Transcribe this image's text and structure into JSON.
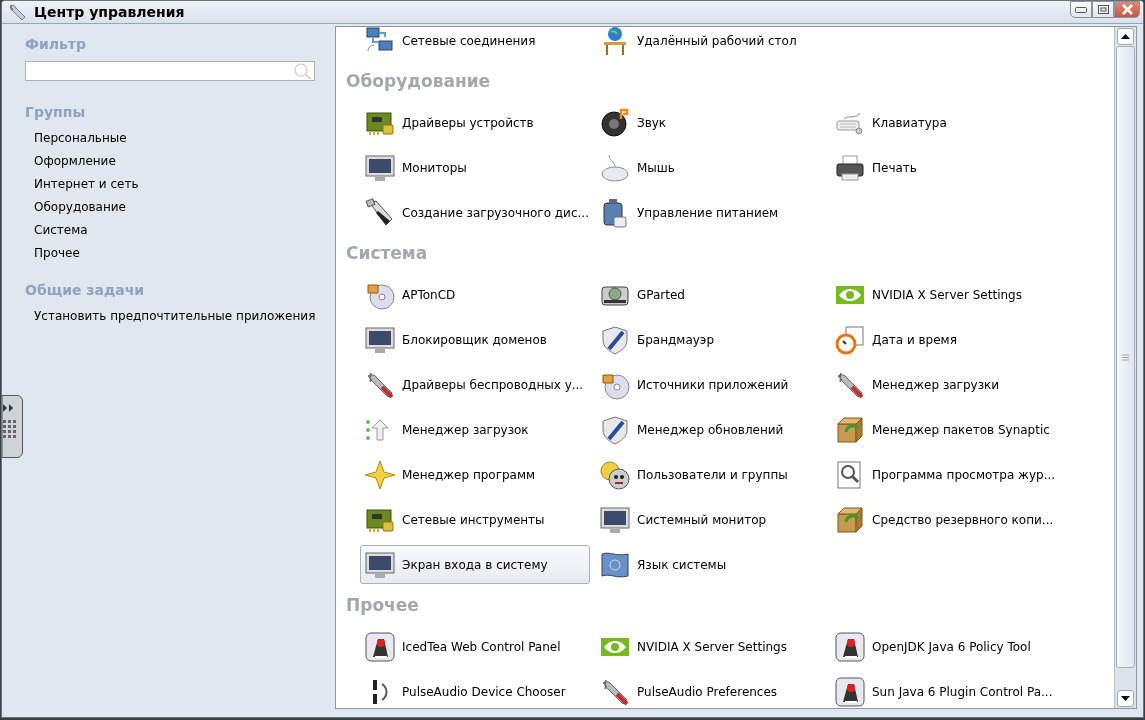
{
  "window": {
    "title": "Центр управления"
  },
  "sidebar": {
    "filter_heading": "Фильтр",
    "groups_heading": "Группы",
    "groups": [
      "Персональные",
      "Оформление",
      "Интернет и сеть",
      "Оборудование",
      "Система",
      "Прочее"
    ],
    "tasks_heading": "Общие задачи",
    "tasks": [
      "Установить предпочтительные приложения"
    ]
  },
  "sections": [
    {
      "items": [
        {
          "label": "Сетевые соединения",
          "selected": false
        },
        {
          "label": "Удалённый рабочий стол",
          "selected": false
        }
      ]
    },
    {
      "heading": "Оборудование",
      "items": [
        {
          "label": "Драйверы устройств",
          "selected": false
        },
        {
          "label": "Звук",
          "selected": false
        },
        {
          "label": "Клавиатура",
          "selected": false
        },
        {
          "label": "Мониторы",
          "selected": false
        },
        {
          "label": "Мышь",
          "selected": false
        },
        {
          "label": "Печать",
          "selected": false
        },
        {
          "label": "Создание загрузочного дис...",
          "selected": false
        },
        {
          "label": "Управление питанием",
          "selected": false
        }
      ]
    },
    {
      "heading": "Система",
      "items": [
        {
          "label": "APTonCD",
          "selected": false
        },
        {
          "label": "GParted",
          "selected": false
        },
        {
          "label": "NVIDIA X Server Settings",
          "selected": false
        },
        {
          "label": "Блокировщик доменов",
          "selected": false
        },
        {
          "label": "Брандмауэр",
          "selected": false
        },
        {
          "label": "Дата и время",
          "selected": false
        },
        {
          "label": "Драйверы беспроводных у...",
          "selected": false
        },
        {
          "label": "Источники приложений",
          "selected": false
        },
        {
          "label": "Менеджер загрузки",
          "selected": false
        },
        {
          "label": "Менеджер загрузок",
          "selected": false
        },
        {
          "label": "Менеджер обновлений",
          "selected": false
        },
        {
          "label": "Менеджер пакетов Synaptic",
          "selected": false
        },
        {
          "label": "Менеджер программ",
          "selected": false
        },
        {
          "label": "Пользователи и группы",
          "selected": false
        },
        {
          "label": "Программа просмотра жур...",
          "selected": false
        },
        {
          "label": "Сетевые инструменты",
          "selected": false
        },
        {
          "label": "Системный монитор",
          "selected": false
        },
        {
          "label": "Средство резервного копи...",
          "selected": false
        },
        {
          "label": "Экран входа в систему",
          "selected": true
        },
        {
          "label": "Язык системы",
          "selected": false
        }
      ]
    },
    {
      "heading": "Прочее",
      "items": [
        {
          "label": "IcedTea Web Control Panel",
          "selected": false
        },
        {
          "label": "NVIDIA X Server Settings",
          "selected": false
        },
        {
          "label": "OpenJDK Java 6 Policy Tool",
          "selected": false
        },
        {
          "label": "PulseAudio Device Chooser",
          "selected": false
        },
        {
          "label": "PulseAudio Preferences",
          "selected": false
        },
        {
          "label": "Sun Java 6 Plugin Control Pa...",
          "selected": false
        }
      ]
    }
  ]
}
